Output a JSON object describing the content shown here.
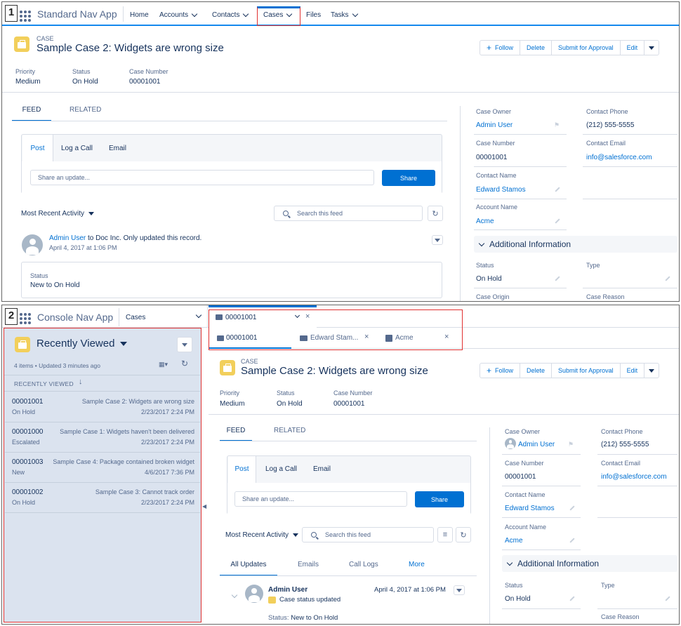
{
  "panel1": {
    "badge": "1",
    "app_name": "Standard Nav App",
    "nav": [
      {
        "label": "Home"
      },
      {
        "label": "Accounts"
      },
      {
        "label": "Contacts"
      },
      {
        "label": "Cases"
      },
      {
        "label": "Files"
      },
      {
        "label": "Tasks"
      }
    ],
    "record_type": "CASE",
    "record_title": "Sample Case 2: Widgets are wrong size",
    "actions": {
      "follow": "Follow",
      "delete": "Delete",
      "submit": "Submit for Approval",
      "edit": "Edit"
    },
    "highlights": [
      {
        "label": "Priority",
        "value": "Medium"
      },
      {
        "label": "Status",
        "value": "On Hold"
      },
      {
        "label": "Case Number",
        "value": "00001001"
      }
    ],
    "tabs": {
      "feed": "FEED",
      "related": "RELATED"
    },
    "publisher": {
      "post": "Post",
      "log_call": "Log a Call",
      "email": "Email",
      "placeholder": "Share an update...",
      "share": "Share"
    },
    "feed_filter": "Most Recent Activity",
    "feed_search_placeholder": "Search this feed",
    "feed_item": {
      "user": "Admin User",
      "text": " to Doc Inc. Only updated this record.",
      "date": "April 4, 2017 at 1:06 PM",
      "field": "Status",
      "change": "New to On Hold"
    },
    "details": {
      "case_owner_label": "Case Owner",
      "case_owner": "Admin User",
      "contact_phone_label": "Contact Phone",
      "contact_phone": "(212) 555-5555",
      "case_number_label": "Case Number",
      "case_number": "00001001",
      "contact_email_label": "Contact Email",
      "contact_email": "info@salesforce.com",
      "contact_name_label": "Contact Name",
      "contact_name": "Edward Stamos",
      "account_name_label": "Account Name",
      "account_name": "Acme",
      "additional_info": "Additional Information",
      "status_label": "Status",
      "status": "On Hold",
      "type_label": "Type",
      "case_origin_label": "Case Origin",
      "case_reason_label": "Case Reason"
    }
  },
  "panel2": {
    "badge": "2",
    "app_name": "Console Nav App",
    "nav_select": "Cases",
    "workspace_tab": "00001001",
    "subtabs": [
      {
        "label": "00001001"
      },
      {
        "label": "Edward Stam..."
      },
      {
        "label": "Acme"
      }
    ],
    "list": {
      "title": "Recently Viewed",
      "meta": "4 items • Updated 3 minutes ago",
      "column": "RECENTLY VIEWED",
      "rows": [
        {
          "num": "00001001",
          "status": "On Hold",
          "subject": "Sample Case 2: Widgets are wrong size",
          "date": "2/23/2017 2:24 PM"
        },
        {
          "num": "00001000",
          "status": "Escalated",
          "subject": "Sample Case 1: Widgets haven't been delivered",
          "date": "2/23/2017 2:24 PM"
        },
        {
          "num": "00001003",
          "status": "New",
          "subject": "Sample Case 4: Package contained broken widget",
          "date": "4/6/2017 7:36 PM"
        },
        {
          "num": "00001002",
          "status": "On Hold",
          "subject": "Sample Case 3: Cannot track order",
          "date": "2/23/2017 2:24 PM"
        }
      ]
    },
    "record_type": "CASE",
    "record_title": "Sample Case 2: Widgets are wrong size",
    "actions": {
      "follow": "Follow",
      "delete": "Delete",
      "submit": "Submit for Approval",
      "edit": "Edit"
    },
    "highlights": [
      {
        "label": "Priority",
        "value": "Medium"
      },
      {
        "label": "Status",
        "value": "On Hold"
      },
      {
        "label": "Case Number",
        "value": "00001001"
      }
    ],
    "tabs": {
      "feed": "FEED",
      "related": "RELATED"
    },
    "publisher": {
      "post": "Post",
      "log_call": "Log a Call",
      "email": "Email",
      "placeholder": "Share an update...",
      "share": "Share"
    },
    "feed_filter": "Most Recent Activity",
    "feed_search_placeholder": "Search this feed",
    "feed_tabs": {
      "all": "All Updates",
      "emails": "Emails",
      "call_logs": "Call Logs",
      "more": "More"
    },
    "feed_item": {
      "user": "Admin User",
      "action": "Case status updated",
      "date": "April 4, 2017 at 1:06 PM",
      "field": "Status:",
      "change": "New to On Hold"
    },
    "details": {
      "case_owner_label": "Case Owner",
      "case_owner": "Admin User",
      "contact_phone_label": "Contact Phone",
      "contact_phone": "(212) 555-5555",
      "case_number_label": "Case Number",
      "case_number": "00001001",
      "contact_email_label": "Contact Email",
      "contact_email": "info@salesforce.com",
      "contact_name_label": "Contact Name",
      "contact_name": "Edward Stamos",
      "account_name_label": "Account Name",
      "account_name": "Acme",
      "additional_info": "Additional Information",
      "status_label": "Status",
      "status": "On Hold",
      "type_label": "Type",
      "case_reason_label": "Case Reason"
    }
  }
}
